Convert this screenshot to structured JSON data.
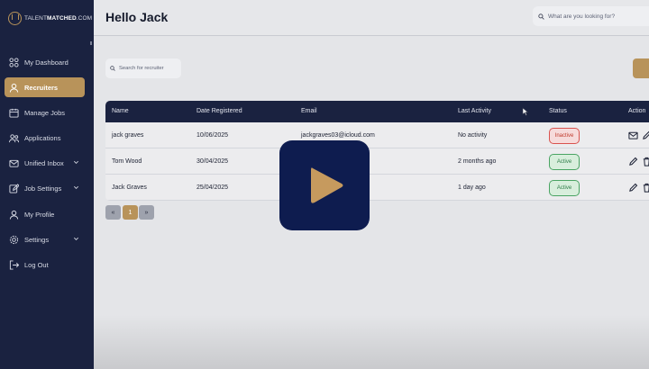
{
  "brand": {
    "prefix": "TALENT",
    "name": "MATCHED",
    "suffix": ".COM",
    "accent": "#b8935a",
    "sidebar_bg": "#1a2240"
  },
  "header": {
    "title": "Hello Jack",
    "search_placeholder": "What are you looking for?"
  },
  "sidebar": {
    "items": [
      {
        "label": "My Dashboard",
        "icon": "dashboard-grid-icon"
      },
      {
        "label": "Recruiters",
        "icon": "user-icon",
        "active": true
      },
      {
        "label": "Manage Jobs",
        "icon": "calendar-icon"
      },
      {
        "label": "Applications",
        "icon": "users-icon"
      },
      {
        "label": "Unified Inbox",
        "icon": "mail-icon",
        "expandable": true
      },
      {
        "label": "Job Settings",
        "icon": "edit-icon",
        "expandable": true
      },
      {
        "label": "My Profile",
        "icon": "user-icon"
      },
      {
        "label": "Settings",
        "icon": "gear-icon",
        "expandable": true
      },
      {
        "label": "Log Out",
        "icon": "logout-icon"
      }
    ]
  },
  "recruiters": {
    "search_placeholder": "Search for recruiter",
    "columns": [
      "Name",
      "Date Registered",
      "Email",
      "Last Activity",
      "Status",
      "Action"
    ],
    "rows": [
      {
        "name": "jack graves",
        "date": "10/06/2025",
        "email": "jackgraves03@icloud.com",
        "activity": "No activity",
        "status": "Inactive"
      },
      {
        "name": "Tom Wood",
        "date": "30/04/2025",
        "email": "",
        "activity": "2 months ago",
        "status": "Active"
      },
      {
        "name": "Jack Graves",
        "date": "25/04/2025",
        "email": "",
        "activity": "1 day ago",
        "status": "Active"
      }
    ],
    "pagination": {
      "prev": "«",
      "current": "1",
      "next": "»"
    }
  },
  "overlay": {
    "icon": "play-icon"
  }
}
